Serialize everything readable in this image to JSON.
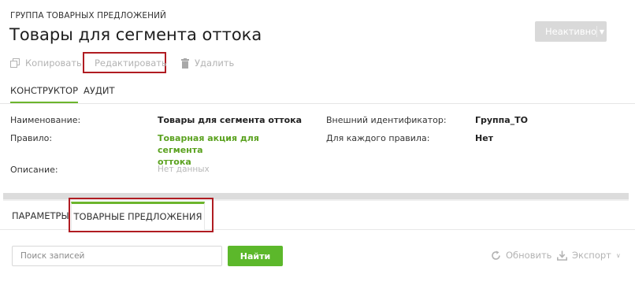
{
  "header": {
    "overline": "ГРУППА ТОВАРНЫХ ПРЕДЛОЖЕНИЙ",
    "title": "Товары для сегмента оттока",
    "status_label": "Неактивно"
  },
  "actions": {
    "copy": "Копировать",
    "edit": "Редактировать",
    "delete": "Удалить"
  },
  "tabs_top": [
    {
      "label": "КОНСТРУКТОР",
      "active": true
    },
    {
      "label": "АУДИТ",
      "active": false
    }
  ],
  "fields": {
    "name_label": "Наименование:",
    "name_value": "Товары для сегмента оттока",
    "rule_label": "Правило:",
    "rule_value_line1": "Товарная акция для сегмента",
    "rule_value_line2": "оттока",
    "description_label": "Описание:",
    "description_value": "Нет данных",
    "external_id_label": "Внешний идентификатор:",
    "external_id_value": "Группа_ТО",
    "each_rule_label": "Для каждого правила:",
    "each_rule_value": "Нет"
  },
  "tabs_bottom": [
    {
      "label": "ПАРАМЕТРЫ",
      "active": false
    },
    {
      "label": "ТОВАРНЫЕ ПРЕДЛОЖЕНИЯ",
      "active": true
    }
  ],
  "search": {
    "placeholder": "Поиск записей",
    "button": "Найти"
  },
  "toolbar": {
    "refresh": "Обновить",
    "export": "Экспорт"
  },
  "colors": {
    "accent_green": "#5cb82b",
    "highlight_red": "#b01c22",
    "disabled_gray": "#d9d9d9"
  }
}
